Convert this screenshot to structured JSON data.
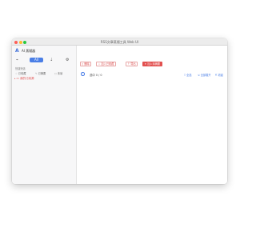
{
  "window": {
    "title": "RSS文章蒸馏工具 Web UI"
  },
  "sidebar": {
    "app_logo": "A",
    "app_name": "AI 蒸馏器",
    "toolbar": {
      "rss_icon": "rss-icon",
      "all_label": "All",
      "sort_icon": "sort-icon",
      "settings_icon": "gear-icon"
    },
    "section_label": "快捷筛选",
    "chips": [
      "已收藏",
      "已摘要",
      "未读"
    ],
    "tree_items": [
      {
        "label": "我的订阅源"
      }
    ]
  },
  "toolbar": {
    "buttons": [
      "删除",
      "加入已收藏",
      "导出",
      "加入待摘要"
    ]
  },
  "selection": {
    "count_text": "选中 0 / 0"
  },
  "actions": [
    "全选",
    "全部展开",
    "收起"
  ],
  "colors": {
    "accent": "#4a7ee6",
    "danger": "#e25150"
  }
}
